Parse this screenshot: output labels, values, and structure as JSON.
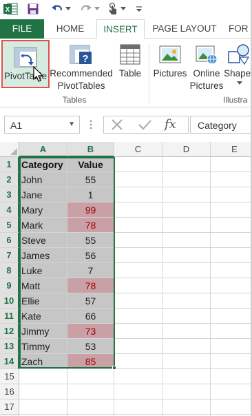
{
  "colors": {
    "accent": "#217346",
    "highlight_fill": "#c9a0a6",
    "highlight_text": "#9c0006"
  },
  "quick_access": {
    "icons": [
      "excel-logo-icon",
      "save-icon",
      "undo-icon",
      "redo-icon",
      "touch-mode-icon",
      "customize-icon"
    ]
  },
  "tabs": [
    {
      "label": "FILE"
    },
    {
      "label": "HOME"
    },
    {
      "label": "INSERT"
    },
    {
      "label": "PAGE LAYOUT"
    },
    {
      "label": "FOR"
    }
  ],
  "ribbon": {
    "pivottable": "PivotTable",
    "recommended_line1": "Recommended",
    "recommended_line2": "PivotTables",
    "table": "Table",
    "pictures": "Pictures",
    "online_line1": "Online",
    "online_line2": "Pictures",
    "shapes": "Shapes",
    "group_tables": "Tables",
    "group_illustrations": "Illustra"
  },
  "formula_bar": {
    "name_box": "A1",
    "fx": "fx",
    "content": "Category"
  },
  "grid": {
    "columns": [
      "A",
      "B",
      "C",
      "D",
      "E"
    ],
    "rows": [
      {
        "n": "1",
        "a": "Category",
        "b": "Value",
        "highlight": false
      },
      {
        "n": "2",
        "a": "John",
        "b": "55",
        "highlight": false
      },
      {
        "n": "3",
        "a": "Jane",
        "b": "1",
        "highlight": false
      },
      {
        "n": "4",
        "a": "Mary",
        "b": "99",
        "highlight": true
      },
      {
        "n": "5",
        "a": "Mark",
        "b": "78",
        "highlight": true
      },
      {
        "n": "6",
        "a": "Steve",
        "b": "55",
        "highlight": false
      },
      {
        "n": "7",
        "a": "James",
        "b": "56",
        "highlight": false
      },
      {
        "n": "8",
        "a": "Luke",
        "b": "7",
        "highlight": false
      },
      {
        "n": "9",
        "a": "Matt",
        "b": "78",
        "highlight": true
      },
      {
        "n": "10",
        "a": "Ellie",
        "b": "57",
        "highlight": false
      },
      {
        "n": "11",
        "a": "Kate",
        "b": "66",
        "highlight": false
      },
      {
        "n": "12",
        "a": "Jimmy",
        "b": "73",
        "highlight": true
      },
      {
        "n": "13",
        "a": "Timmy",
        "b": "53",
        "highlight": false
      },
      {
        "n": "14",
        "a": "Zach",
        "b": "85",
        "highlight": true
      },
      {
        "n": "15",
        "a": "",
        "b": "",
        "highlight": false
      },
      {
        "n": "16",
        "a": "",
        "b": "",
        "highlight": false
      },
      {
        "n": "17",
        "a": "",
        "b": "",
        "highlight": false
      },
      {
        "n": "18",
        "a": "",
        "b": "",
        "highlight": false
      }
    ]
  }
}
